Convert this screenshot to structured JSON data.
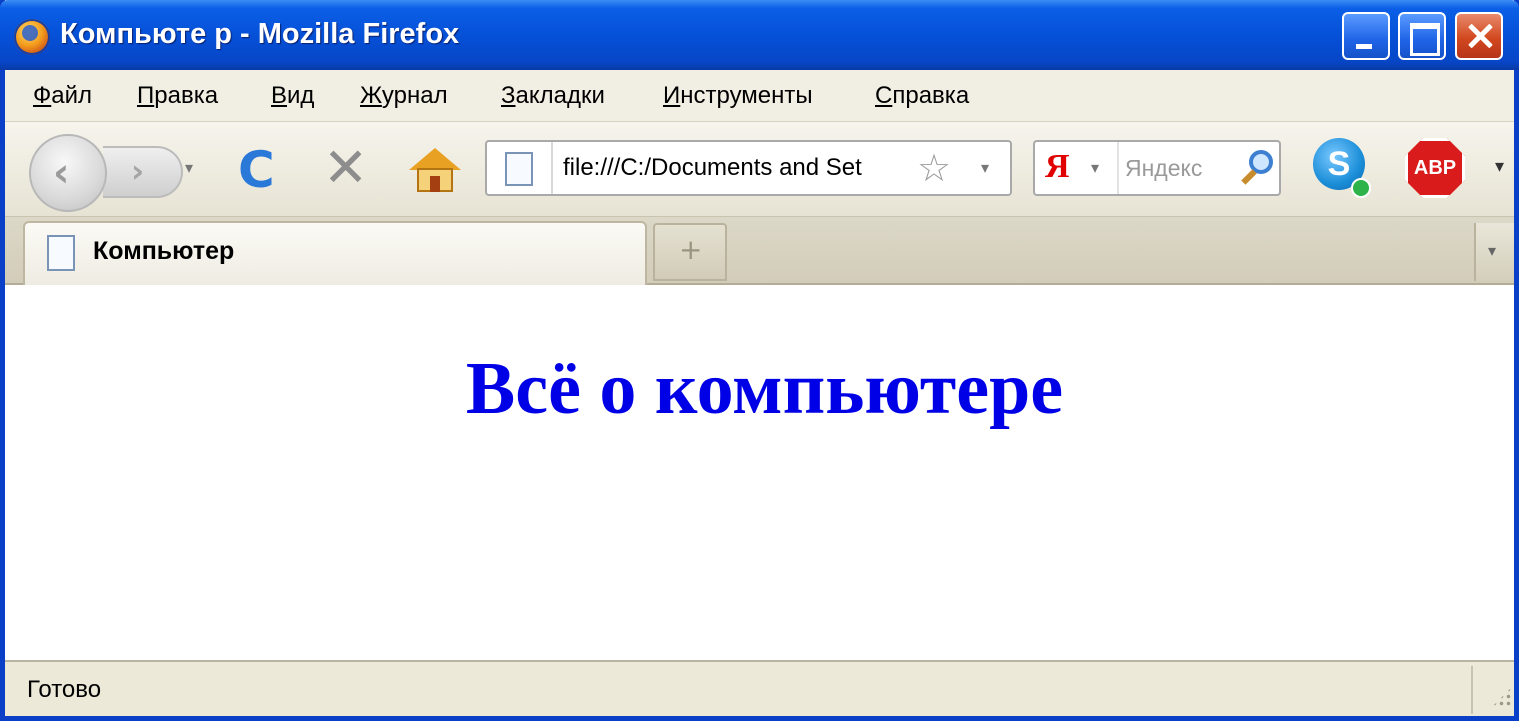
{
  "window": {
    "title": "Компьюте р - Mozilla Firefox",
    "app_icon": "firefox-icon"
  },
  "menu": {
    "items": [
      {
        "first": "Ф",
        "rest": "айл"
      },
      {
        "first": "П",
        "rest": "равка"
      },
      {
        "first": "В",
        "rest": "ид"
      },
      {
        "first": "Ж",
        "rest": "урнал"
      },
      {
        "first": "З",
        "rest": "акладки"
      },
      {
        "first": "И",
        "rest": "нструменты"
      },
      {
        "first": "С",
        "rest": "правка"
      }
    ]
  },
  "toolbar": {
    "back_glyph": "‹",
    "forward_glyph": "›",
    "dropdown_glyph": "▾",
    "reload_glyph": "C",
    "stop_glyph": "✕",
    "url": "file:///C:/Documents and Set",
    "bookmark_star_glyph": "☆",
    "search_engine": "Я",
    "search_placeholder": "Яндекс",
    "abp_label": "ABP",
    "skype_letter": "S",
    "overflow_glyph": "▾"
  },
  "tabs": {
    "active_title": "Компьютер",
    "new_tab_glyph": "+",
    "list_glyph": "▾"
  },
  "page": {
    "heading": "Всё о компьютере"
  },
  "status": {
    "text": "Готово"
  }
}
